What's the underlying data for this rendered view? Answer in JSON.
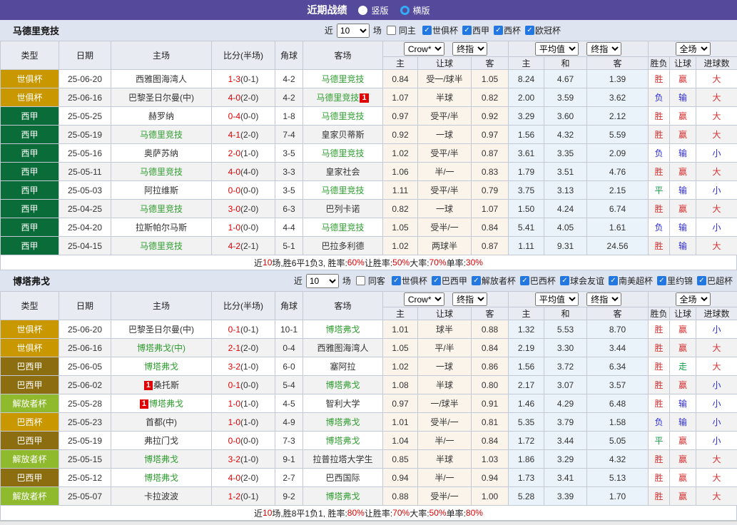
{
  "top_bar": {
    "title": "近期战绩",
    "view_options": [
      {
        "label": "竖版",
        "selected": false
      },
      {
        "label": "横版",
        "selected": true
      }
    ]
  },
  "filters_common": {
    "near": "近",
    "games": "场"
  },
  "table_head": {
    "cols": [
      "类型",
      "日期",
      "主场",
      "比分(半场)",
      "角球",
      "客场"
    ],
    "sub_cols": [
      "主",
      "让球",
      "客",
      "主",
      "和",
      "客",
      "胜负",
      "让球",
      "进球数"
    ],
    "selects": {
      "crow": "Crow*",
      "final1": "终指",
      "avg": "平均值",
      "final2": "终指",
      "full": "全场"
    }
  },
  "league_colors": {
    "世俱杯": "#c99700",
    "西甲": "#0a6c38",
    "巴西甲": "#8c6d10",
    "解放者杯": "#8fba2e",
    "巴西杯": "#c99700"
  },
  "colors": {
    "accent_purple": "#55499b",
    "self_team_green": "#2f9d2f",
    "score_red": "#e00000",
    "win_red": "#d93030",
    "draw_green": "#13a04a",
    "lose_blue": "#2b2bd5",
    "checkbox_blue": "#2277e0"
  },
  "sections": [
    {
      "team": "马德里竞技",
      "filter": {
        "count": "10",
        "same_label": "同主",
        "same_checked": false,
        "leagues": [
          {
            "label": "世俱杯",
            "checked": true
          },
          {
            "label": "西甲",
            "checked": true
          },
          {
            "label": "西杯",
            "checked": true
          },
          {
            "label": "欧冠杯",
            "checked": true
          }
        ]
      },
      "rows": [
        {
          "league": "世俱杯",
          "date": "25-06-20",
          "home": {
            "name": "西雅图海湾人"
          },
          "score": {
            "ft": "1-3",
            "ht": "(0-1)"
          },
          "corner": "4-2",
          "away": {
            "name": "马德里竞技",
            "self": true
          },
          "odds": [
            "0.84",
            "受一/球半",
            "1.05",
            "8.24",
            "4.67",
            "1.39"
          ],
          "res": [
            "胜",
            "赢",
            "大"
          ]
        },
        {
          "league": "世俱杯",
          "date": "25-06-16",
          "home": {
            "name": "巴黎圣日尔曼(中)"
          },
          "score": {
            "ft": "4-0",
            "ht": "(2-0)"
          },
          "corner": "4-2",
          "away": {
            "name": "马德里竞技",
            "self": true,
            "badge": "1",
            "badge_pos": "after"
          },
          "odds": [
            "1.07",
            "半球",
            "0.82",
            "2.00",
            "3.59",
            "3.62"
          ],
          "res": [
            "负",
            "输",
            "大"
          ]
        },
        {
          "league": "西甲",
          "date": "25-05-25",
          "home": {
            "name": "赫罗纳"
          },
          "score": {
            "ft": "0-4",
            "ht": "(0-0)"
          },
          "corner": "1-8",
          "away": {
            "name": "马德里竞技",
            "self": true
          },
          "odds": [
            "0.97",
            "受平/半",
            "0.92",
            "3.29",
            "3.60",
            "2.12"
          ],
          "res": [
            "胜",
            "赢",
            "大"
          ]
        },
        {
          "league": "西甲",
          "date": "25-05-19",
          "home": {
            "name": "马德里竞技",
            "self": true
          },
          "score": {
            "ft": "4-1",
            "ht": "(2-0)"
          },
          "corner": "7-4",
          "away": {
            "name": "皇家贝蒂斯"
          },
          "odds": [
            "0.92",
            "一球",
            "0.97",
            "1.56",
            "4.32",
            "5.59"
          ],
          "res": [
            "胜",
            "赢",
            "大"
          ]
        },
        {
          "league": "西甲",
          "date": "25-05-16",
          "home": {
            "name": "奥萨苏纳"
          },
          "score": {
            "ft": "2-0",
            "ht": "(1-0)"
          },
          "corner": "3-5",
          "away": {
            "name": "马德里竞技",
            "self": true
          },
          "odds": [
            "1.02",
            "受平/半",
            "0.87",
            "3.61",
            "3.35",
            "2.09"
          ],
          "res": [
            "负",
            "输",
            "小"
          ]
        },
        {
          "league": "西甲",
          "date": "25-05-11",
          "home": {
            "name": "马德里竞技",
            "self": true
          },
          "score": {
            "ft": "4-0",
            "ht": "(4-0)"
          },
          "corner": "3-3",
          "away": {
            "name": "皇家社会"
          },
          "odds": [
            "1.06",
            "半/一",
            "0.83",
            "1.79",
            "3.51",
            "4.76"
          ],
          "res": [
            "胜",
            "赢",
            "大"
          ]
        },
        {
          "league": "西甲",
          "date": "25-05-03",
          "home": {
            "name": "阿拉维斯"
          },
          "score": {
            "ft": "0-0",
            "ht": "(0-0)"
          },
          "corner": "3-5",
          "away": {
            "name": "马德里竞技",
            "self": true
          },
          "odds": [
            "1.11",
            "受平/半",
            "0.79",
            "3.75",
            "3.13",
            "2.15"
          ],
          "res": [
            "平",
            "输",
            "小"
          ]
        },
        {
          "league": "西甲",
          "date": "25-04-25",
          "home": {
            "name": "马德里竞技",
            "self": true
          },
          "score": {
            "ft": "3-0",
            "ht": "(2-0)"
          },
          "corner": "6-3",
          "away": {
            "name": "巴列卡诺"
          },
          "odds": [
            "0.82",
            "一球",
            "1.07",
            "1.50",
            "4.24",
            "6.74"
          ],
          "res": [
            "胜",
            "赢",
            "大"
          ]
        },
        {
          "league": "西甲",
          "date": "25-04-20",
          "home": {
            "name": "拉斯帕尔马斯"
          },
          "score": {
            "ft": "1-0",
            "ht": "(0-0)"
          },
          "corner": "4-4",
          "away": {
            "name": "马德里竞技",
            "self": true
          },
          "odds": [
            "1.05",
            "受半/一",
            "0.84",
            "5.41",
            "4.05",
            "1.61"
          ],
          "res": [
            "负",
            "输",
            "小"
          ]
        },
        {
          "league": "西甲",
          "date": "25-04-15",
          "home": {
            "name": "马德里竞技",
            "self": true
          },
          "score": {
            "ft": "4-2",
            "ht": "(2-1)"
          },
          "corner": "5-1",
          "away": {
            "name": "巴拉多利德"
          },
          "odds": [
            "1.02",
            "两球半",
            "0.87",
            "1.11",
            "9.31",
            "24.56"
          ],
          "res": [
            "胜",
            "输",
            "大"
          ]
        }
      ],
      "summary": [
        {
          "t": "近"
        },
        {
          "t": "10",
          "r": 1
        },
        {
          "t": "场,胜6平1负3, 胜率:"
        },
        {
          "t": "60%",
          "r": 1
        },
        {
          "t": " 让胜率:"
        },
        {
          "t": "50%",
          "r": 1
        },
        {
          "t": " 大率:"
        },
        {
          "t": "70%",
          "r": 1
        },
        {
          "t": " 单率:"
        },
        {
          "t": "30%",
          "r": 1
        }
      ]
    },
    {
      "team": "博塔弗戈",
      "filter": {
        "count": "10",
        "same_label": "同客",
        "same_checked": false,
        "leagues": [
          {
            "label": "世俱杯",
            "checked": true
          },
          {
            "label": "巴西甲",
            "checked": true
          },
          {
            "label": "解放者杯",
            "checked": true
          },
          {
            "label": "巴西杯",
            "checked": true
          },
          {
            "label": "球会友谊",
            "checked": true
          },
          {
            "label": "南美超杯",
            "checked": true
          },
          {
            "label": "里约锦",
            "checked": true
          },
          {
            "label": "巴超杯",
            "checked": true
          }
        ]
      },
      "rows": [
        {
          "league": "世俱杯",
          "date": "25-06-20",
          "home": {
            "name": "巴黎圣日尔曼(中)"
          },
          "score": {
            "ft": "0-1",
            "ht": "(0-1)"
          },
          "corner": "10-1",
          "away": {
            "name": "博塔弗戈",
            "self": true
          },
          "odds": [
            "1.01",
            "球半",
            "0.88",
            "1.32",
            "5.53",
            "8.70"
          ],
          "res": [
            "胜",
            "赢",
            "小"
          ]
        },
        {
          "league": "世俱杯",
          "date": "25-06-16",
          "home": {
            "name": "博塔弗戈(中)",
            "self": true
          },
          "score": {
            "ft": "2-1",
            "ht": "(2-0)"
          },
          "corner": "0-4",
          "away": {
            "name": "西雅图海湾人"
          },
          "odds": [
            "1.05",
            "平/半",
            "0.84",
            "2.19",
            "3.30",
            "3.44"
          ],
          "res": [
            "胜",
            "赢",
            "大"
          ]
        },
        {
          "league": "巴西甲",
          "date": "25-06-05",
          "home": {
            "name": "博塔弗戈",
            "self": true
          },
          "score": {
            "ft": "3-2",
            "ht": "(1-0)"
          },
          "corner": "6-0",
          "away": {
            "name": "塞阿拉"
          },
          "odds": [
            "1.02",
            "一球",
            "0.86",
            "1.56",
            "3.72",
            "6.34"
          ],
          "res": [
            "胜",
            "走",
            "大"
          ]
        },
        {
          "league": "巴西甲",
          "date": "25-06-02",
          "home": {
            "name": "桑托斯",
            "badge": "1",
            "badge_pos": "before"
          },
          "score": {
            "ft": "0-1",
            "ht": "(0-0)"
          },
          "corner": "5-4",
          "away": {
            "name": "博塔弗戈",
            "self": true
          },
          "odds": [
            "1.08",
            "半球",
            "0.80",
            "2.17",
            "3.07",
            "3.57"
          ],
          "res": [
            "胜",
            "赢",
            "小"
          ]
        },
        {
          "league": "解放者杯",
          "date": "25-05-28",
          "home": {
            "name": "博塔弗戈",
            "self": true,
            "badge": "1",
            "badge_pos": "before"
          },
          "score": {
            "ft": "1-0",
            "ht": "(1-0)"
          },
          "corner": "4-5",
          "away": {
            "name": "智利大学"
          },
          "odds": [
            "0.97",
            "一/球半",
            "0.91",
            "1.46",
            "4.29",
            "6.48"
          ],
          "res": [
            "胜",
            "输",
            "小"
          ]
        },
        {
          "league": "巴西杯",
          "date": "25-05-23",
          "home": {
            "name": "首都(中)"
          },
          "score": {
            "ft": "1-0",
            "ht": "(1-0)"
          },
          "corner": "4-9",
          "away": {
            "name": "博塔弗戈",
            "self": true
          },
          "odds": [
            "1.01",
            "受半/一",
            "0.81",
            "5.35",
            "3.79",
            "1.58"
          ],
          "res": [
            "负",
            "输",
            "小"
          ]
        },
        {
          "league": "巴西甲",
          "date": "25-05-19",
          "home": {
            "name": "弗拉门戈"
          },
          "score": {
            "ft": "0-0",
            "ht": "(0-0)"
          },
          "corner": "7-3",
          "away": {
            "name": "博塔弗戈",
            "self": true
          },
          "odds": [
            "1.04",
            "半/一",
            "0.84",
            "1.72",
            "3.44",
            "5.05"
          ],
          "res": [
            "平",
            "赢",
            "小"
          ]
        },
        {
          "league": "解放者杯",
          "date": "25-05-15",
          "home": {
            "name": "博塔弗戈",
            "self": true
          },
          "score": {
            "ft": "3-2",
            "ht": "(1-0)"
          },
          "corner": "9-1",
          "away": {
            "name": "拉普拉塔大学生"
          },
          "odds": [
            "0.85",
            "半球",
            "1.03",
            "1.86",
            "3.29",
            "4.32"
          ],
          "res": [
            "胜",
            "赢",
            "大"
          ]
        },
        {
          "league": "巴西甲",
          "date": "25-05-12",
          "home": {
            "name": "博塔弗戈",
            "self": true
          },
          "score": {
            "ft": "4-0",
            "ht": "(2-0)"
          },
          "corner": "2-7",
          "away": {
            "name": "巴西国际"
          },
          "odds": [
            "0.94",
            "半/一",
            "0.94",
            "1.73",
            "3.41",
            "5.13"
          ],
          "res": [
            "胜",
            "赢",
            "大"
          ]
        },
        {
          "league": "解放者杯",
          "date": "25-05-07",
          "home": {
            "name": "卡拉波波"
          },
          "score": {
            "ft": "1-2",
            "ht": "(0-1)"
          },
          "corner": "9-2",
          "away": {
            "name": "博塔弗戈",
            "self": true
          },
          "odds": [
            "0.88",
            "受半/一",
            "1.00",
            "5.28",
            "3.39",
            "1.70"
          ],
          "res": [
            "胜",
            "赢",
            "大"
          ]
        }
      ],
      "summary": [
        {
          "t": "近"
        },
        {
          "t": "10",
          "r": 1
        },
        {
          "t": "场,胜8平1负1, 胜率:"
        },
        {
          "t": "80%",
          "r": 1
        },
        {
          "t": " 让胜率:"
        },
        {
          "t": "70%",
          "r": 1
        },
        {
          "t": " 大率:"
        },
        {
          "t": "50%",
          "r": 1
        },
        {
          "t": " 单率:"
        },
        {
          "t": "80%",
          "r": 1
        }
      ]
    }
  ]
}
